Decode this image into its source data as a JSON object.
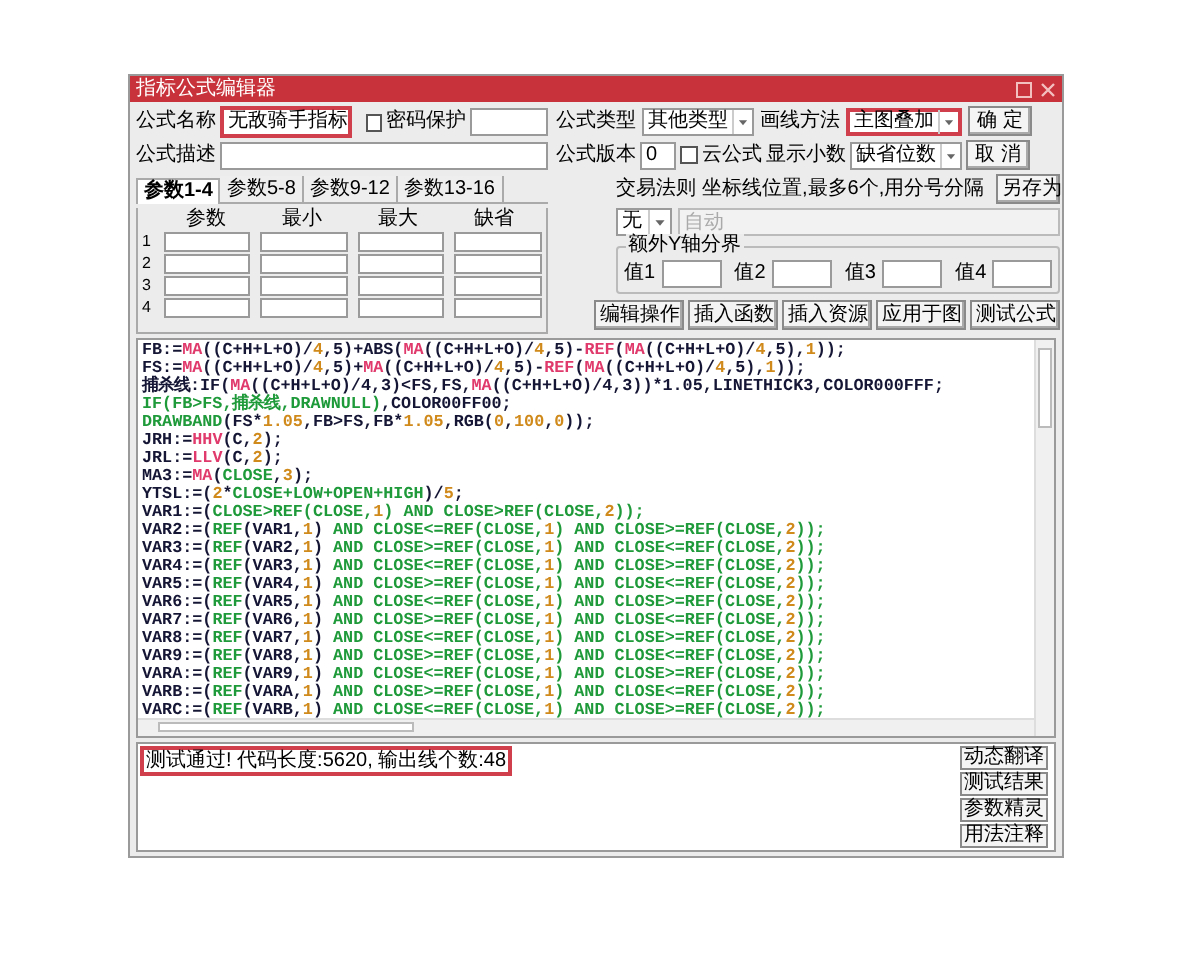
{
  "window": {
    "title": "指标公式编辑器"
  },
  "formula_name": {
    "label": "公式名称",
    "value": "无敌骑手指标",
    "highlighted": true
  },
  "password": {
    "label": "密码保护",
    "checked": false
  },
  "description": {
    "label": "公式描述"
  },
  "param_tabs": [
    {
      "label": "参数1-4",
      "selected": true
    },
    {
      "label": "参数5-8",
      "selected": false
    },
    {
      "label": "参数9-12",
      "selected": false
    },
    {
      "label": "参数13-16",
      "selected": false
    }
  ],
  "param_table": {
    "columns": [
      "参数",
      "最小",
      "最大",
      "缺省"
    ],
    "rows": [
      "1",
      "2",
      "3",
      "4"
    ]
  },
  "formula_type": {
    "label": "公式类型",
    "value": "其他类型"
  },
  "draw_method": {
    "label": "画线方法",
    "value": "主图叠加",
    "highlighted": true
  },
  "version": {
    "label": "公式版本",
    "value": "0"
  },
  "cloud": {
    "label": "云公式",
    "checked": false
  },
  "decimals": {
    "label": "显示小数",
    "value": "缺省位数"
  },
  "trade_rule": {
    "label": "交易法则",
    "value": "无"
  },
  "axis_hint": "坐标线位置,最多6个,用分号分隔",
  "axis_positions": {
    "placeholder": "自动"
  },
  "y_axis_group": {
    "title": "额外Y轴分界",
    "fields": [
      "值1",
      "值2",
      "值3",
      "值4"
    ]
  },
  "side_buttons": [
    "确 定",
    "取 消",
    "另存为"
  ],
  "tool_buttons": [
    "编辑操作",
    "插入函数",
    "插入资源",
    "应用于图",
    "测试公式"
  ],
  "code_lines": [
    [
      {
        "kind": "plain",
        "text": "FB:="
      },
      {
        "kind": "func",
        "text": "MA"
      },
      {
        "kind": "plain",
        "text": "((C+H+L+O)/"
      },
      {
        "kind": "num",
        "text": "4"
      },
      {
        "kind": "plain",
        "text": ",5)+ABS("
      },
      {
        "kind": "func",
        "text": "MA"
      },
      {
        "kind": "plain",
        "text": "((C+H+L+O)/"
      },
      {
        "kind": "num",
        "text": "4"
      },
      {
        "kind": "plain",
        "text": ",5)-"
      },
      {
        "kind": "func",
        "text": "REF"
      },
      {
        "kind": "plain",
        "text": "("
      },
      {
        "kind": "func",
        "text": "MA"
      },
      {
        "kind": "plain",
        "text": "((C+H+L+O)/"
      },
      {
        "kind": "num",
        "text": "4"
      },
      {
        "kind": "plain",
        "text": ",5),"
      },
      {
        "kind": "num",
        "text": "1"
      },
      {
        "kind": "plain",
        "text": "));"
      }
    ],
    [
      {
        "kind": "plain",
        "text": "FS:="
      },
      {
        "kind": "func",
        "text": "MA"
      },
      {
        "kind": "plain",
        "text": "((C+H+L+O)/"
      },
      {
        "kind": "num",
        "text": "4"
      },
      {
        "kind": "plain",
        "text": ",5)+"
      },
      {
        "kind": "func",
        "text": "MA"
      },
      {
        "kind": "plain",
        "text": "((C+H+L+O)/"
      },
      {
        "kind": "num",
        "text": "4"
      },
      {
        "kind": "plain",
        "text": ",5)-"
      },
      {
        "kind": "func",
        "text": "REF"
      },
      {
        "kind": "plain",
        "text": "("
      },
      {
        "kind": "func",
        "text": "MA"
      },
      {
        "kind": "plain",
        "text": "((C+H+L+O)/"
      },
      {
        "kind": "num",
        "text": "4"
      },
      {
        "kind": "plain",
        "text": ",5),"
      },
      {
        "kind": "num",
        "text": "1"
      },
      {
        "kind": "plain",
        "text": "));"
      }
    ],
    [
      {
        "kind": "plain",
        "text": "捕杀线:IF("
      },
      {
        "kind": "func",
        "text": "MA"
      },
      {
        "kind": "plain",
        "text": "((C+H+L+O)/4,3)<FS,FS,"
      },
      {
        "kind": "func",
        "text": "MA"
      },
      {
        "kind": "plain",
        "text": "((C+H+L+O)/4,3))*1.05,LINETHICK3,COLOR000FFF;"
      }
    ],
    [
      {
        "kind": "green",
        "text": "IF(FB>FS,捕杀线,DRAWNULL)"
      },
      {
        "kind": "plain",
        "text": ",COLOR00FF00;"
      }
    ],
    [
      {
        "kind": "green",
        "text": "DRAWBAND"
      },
      {
        "kind": "plain",
        "text": "(FS*"
      },
      {
        "kind": "num",
        "text": "1.05"
      },
      {
        "kind": "plain",
        "text": ",FB>FS,FB*"
      },
      {
        "kind": "num",
        "text": "1.05"
      },
      {
        "kind": "plain",
        "text": ",RGB("
      },
      {
        "kind": "num",
        "text": "0"
      },
      {
        "kind": "plain",
        "text": ","
      },
      {
        "kind": "num",
        "text": "100"
      },
      {
        "kind": "plain",
        "text": ","
      },
      {
        "kind": "num",
        "text": "0"
      },
      {
        "kind": "plain",
        "text": "));"
      }
    ],
    [
      {
        "kind": "plain",
        "text": "JRH:="
      },
      {
        "kind": "func",
        "text": "HHV"
      },
      {
        "kind": "plain",
        "text": "(C,"
      },
      {
        "kind": "num",
        "text": "2"
      },
      {
        "kind": "plain",
        "text": ");"
      }
    ],
    [
      {
        "kind": "plain",
        "text": "JRL:="
      },
      {
        "kind": "func",
        "text": "LLV"
      },
      {
        "kind": "plain",
        "text": "(C,"
      },
      {
        "kind": "num",
        "text": "2"
      },
      {
        "kind": "plain",
        "text": ");"
      }
    ],
    [
      {
        "kind": "plain",
        "text": "MA3:="
      },
      {
        "kind": "func",
        "text": "MA"
      },
      {
        "kind": "plain",
        "text": "("
      },
      {
        "kind": "green",
        "text": "CLOSE"
      },
      {
        "kind": "plain",
        "text": ","
      },
      {
        "kind": "num",
        "text": "3"
      },
      {
        "kind": "plain",
        "text": ");"
      }
    ],
    [
      {
        "kind": "plain",
        "text": "YTSL:=("
      },
      {
        "kind": "num",
        "text": "2"
      },
      {
        "kind": "plain",
        "text": "*"
      },
      {
        "kind": "green",
        "text": "CLOSE+LOW+OPEN+HIGH"
      },
      {
        "kind": "plain",
        "text": ")/"
      },
      {
        "kind": "num",
        "text": "5"
      },
      {
        "kind": "plain",
        "text": ";"
      }
    ],
    [
      {
        "kind": "plain",
        "text": "VAR1:=("
      },
      {
        "kind": "green",
        "text": "CLOSE>REF(CLOSE,"
      },
      {
        "kind": "num",
        "text": "1"
      },
      {
        "kind": "green",
        "text": ") AND CLOSE>REF(CLOSE,"
      },
      {
        "kind": "num",
        "text": "2"
      },
      {
        "kind": "green",
        "text": "));"
      }
    ],
    [
      {
        "kind": "plain",
        "text": "VAR2:=("
      },
      {
        "kind": "green",
        "text": "REF"
      },
      {
        "kind": "plain",
        "text": "(VAR1,"
      },
      {
        "kind": "num",
        "text": "1"
      },
      {
        "kind": "plain",
        "text": ") "
      },
      {
        "kind": "green",
        "text": "AND CLOSE<=REF(CLOSE,"
      },
      {
        "kind": "num",
        "text": "1"
      },
      {
        "kind": "green",
        "text": ") AND CLOSE>=REF(CLOSE,"
      },
      {
        "kind": "num",
        "text": "2"
      },
      {
        "kind": "green",
        "text": "));"
      }
    ],
    [
      {
        "kind": "plain",
        "text": "VAR3:=("
      },
      {
        "kind": "green",
        "text": "REF"
      },
      {
        "kind": "plain",
        "text": "(VAR2,"
      },
      {
        "kind": "num",
        "text": "1"
      },
      {
        "kind": "plain",
        "text": ") "
      },
      {
        "kind": "green",
        "text": "AND CLOSE>=REF(CLOSE,"
      },
      {
        "kind": "num",
        "text": "1"
      },
      {
        "kind": "green",
        "text": ") AND CLOSE<=REF(CLOSE,"
      },
      {
        "kind": "num",
        "text": "2"
      },
      {
        "kind": "green",
        "text": "));"
      }
    ],
    [
      {
        "kind": "plain",
        "text": "VAR4:=("
      },
      {
        "kind": "green",
        "text": "REF"
      },
      {
        "kind": "plain",
        "text": "(VAR3,"
      },
      {
        "kind": "num",
        "text": "1"
      },
      {
        "kind": "plain",
        "text": ") "
      },
      {
        "kind": "green",
        "text": "AND CLOSE<=REF(CLOSE,"
      },
      {
        "kind": "num",
        "text": "1"
      },
      {
        "kind": "green",
        "text": ") AND CLOSE>=REF(CLOSE,"
      },
      {
        "kind": "num",
        "text": "2"
      },
      {
        "kind": "green",
        "text": "));"
      }
    ],
    [
      {
        "kind": "plain",
        "text": "VAR5:=("
      },
      {
        "kind": "green",
        "text": "REF"
      },
      {
        "kind": "plain",
        "text": "(VAR4,"
      },
      {
        "kind": "num",
        "text": "1"
      },
      {
        "kind": "plain",
        "text": ") "
      },
      {
        "kind": "green",
        "text": "AND CLOSE>=REF(CLOSE,"
      },
      {
        "kind": "num",
        "text": "1"
      },
      {
        "kind": "green",
        "text": ") AND CLOSE<=REF(CLOSE,"
      },
      {
        "kind": "num",
        "text": "2"
      },
      {
        "kind": "green",
        "text": "));"
      }
    ],
    [
      {
        "kind": "plain",
        "text": "VAR6:=("
      },
      {
        "kind": "green",
        "text": "REF"
      },
      {
        "kind": "plain",
        "text": "(VAR5,"
      },
      {
        "kind": "num",
        "text": "1"
      },
      {
        "kind": "plain",
        "text": ") "
      },
      {
        "kind": "green",
        "text": "AND CLOSE<=REF(CLOSE,"
      },
      {
        "kind": "num",
        "text": "1"
      },
      {
        "kind": "green",
        "text": ") AND CLOSE>=REF(CLOSE,"
      },
      {
        "kind": "num",
        "text": "2"
      },
      {
        "kind": "green",
        "text": "));"
      }
    ],
    [
      {
        "kind": "plain",
        "text": "VAR7:=("
      },
      {
        "kind": "green",
        "text": "REF"
      },
      {
        "kind": "plain",
        "text": "(VAR6,"
      },
      {
        "kind": "num",
        "text": "1"
      },
      {
        "kind": "plain",
        "text": ") "
      },
      {
        "kind": "green",
        "text": "AND CLOSE>=REF(CLOSE,"
      },
      {
        "kind": "num",
        "text": "1"
      },
      {
        "kind": "green",
        "text": ") AND CLOSE<=REF(CLOSE,"
      },
      {
        "kind": "num",
        "text": "2"
      },
      {
        "kind": "green",
        "text": "));"
      }
    ],
    [
      {
        "kind": "plain",
        "text": "VAR8:=("
      },
      {
        "kind": "green",
        "text": "REF"
      },
      {
        "kind": "plain",
        "text": "(VAR7,"
      },
      {
        "kind": "num",
        "text": "1"
      },
      {
        "kind": "plain",
        "text": ") "
      },
      {
        "kind": "green",
        "text": "AND CLOSE<=REF(CLOSE,"
      },
      {
        "kind": "num",
        "text": "1"
      },
      {
        "kind": "green",
        "text": ") AND CLOSE>=REF(CLOSE,"
      },
      {
        "kind": "num",
        "text": "2"
      },
      {
        "kind": "green",
        "text": "));"
      }
    ],
    [
      {
        "kind": "plain",
        "text": "VAR9:=("
      },
      {
        "kind": "green",
        "text": "REF"
      },
      {
        "kind": "plain",
        "text": "(VAR8,"
      },
      {
        "kind": "num",
        "text": "1"
      },
      {
        "kind": "plain",
        "text": ") "
      },
      {
        "kind": "green",
        "text": "AND CLOSE>=REF(CLOSE,"
      },
      {
        "kind": "num",
        "text": "1"
      },
      {
        "kind": "green",
        "text": ") AND CLOSE<=REF(CLOSE,"
      },
      {
        "kind": "num",
        "text": "2"
      },
      {
        "kind": "green",
        "text": "));"
      }
    ],
    [
      {
        "kind": "plain",
        "text": "VARA:=("
      },
      {
        "kind": "green",
        "text": "REF"
      },
      {
        "kind": "plain",
        "text": "(VAR9,"
      },
      {
        "kind": "num",
        "text": "1"
      },
      {
        "kind": "plain",
        "text": ") "
      },
      {
        "kind": "green",
        "text": "AND CLOSE<=REF(CLOSE,"
      },
      {
        "kind": "num",
        "text": "1"
      },
      {
        "kind": "green",
        "text": ") AND CLOSE>=REF(CLOSE,"
      },
      {
        "kind": "num",
        "text": "2"
      },
      {
        "kind": "green",
        "text": "));"
      }
    ],
    [
      {
        "kind": "plain",
        "text": "VARB:=("
      },
      {
        "kind": "green",
        "text": "REF"
      },
      {
        "kind": "plain",
        "text": "(VARA,"
      },
      {
        "kind": "num",
        "text": "1"
      },
      {
        "kind": "plain",
        "text": ") "
      },
      {
        "kind": "green",
        "text": "AND CLOSE>=REF(CLOSE,"
      },
      {
        "kind": "num",
        "text": "1"
      },
      {
        "kind": "green",
        "text": ") AND CLOSE<=REF(CLOSE,"
      },
      {
        "kind": "num",
        "text": "2"
      },
      {
        "kind": "green",
        "text": "));"
      }
    ],
    [
      {
        "kind": "plain",
        "text": "VARC:=("
      },
      {
        "kind": "green",
        "text": "REF"
      },
      {
        "kind": "plain",
        "text": "(VARB,"
      },
      {
        "kind": "num",
        "text": "1"
      },
      {
        "kind": "plain",
        "text": ") "
      },
      {
        "kind": "green",
        "text": "AND CLOSE<=REF(CLOSE,"
      },
      {
        "kind": "num",
        "text": "1"
      },
      {
        "kind": "green",
        "text": ") AND CLOSE>=REF(CLOSE,"
      },
      {
        "kind": "num",
        "text": "2"
      },
      {
        "kind": "green",
        "text": "));"
      }
    ]
  ],
  "message": {
    "text": "测试通过! 代码长度:5620, 输出线个数:48",
    "highlighted": true
  },
  "bottom_buttons": [
    "动态翻译",
    "测试结果",
    "参数精灵",
    "用法注释"
  ]
}
